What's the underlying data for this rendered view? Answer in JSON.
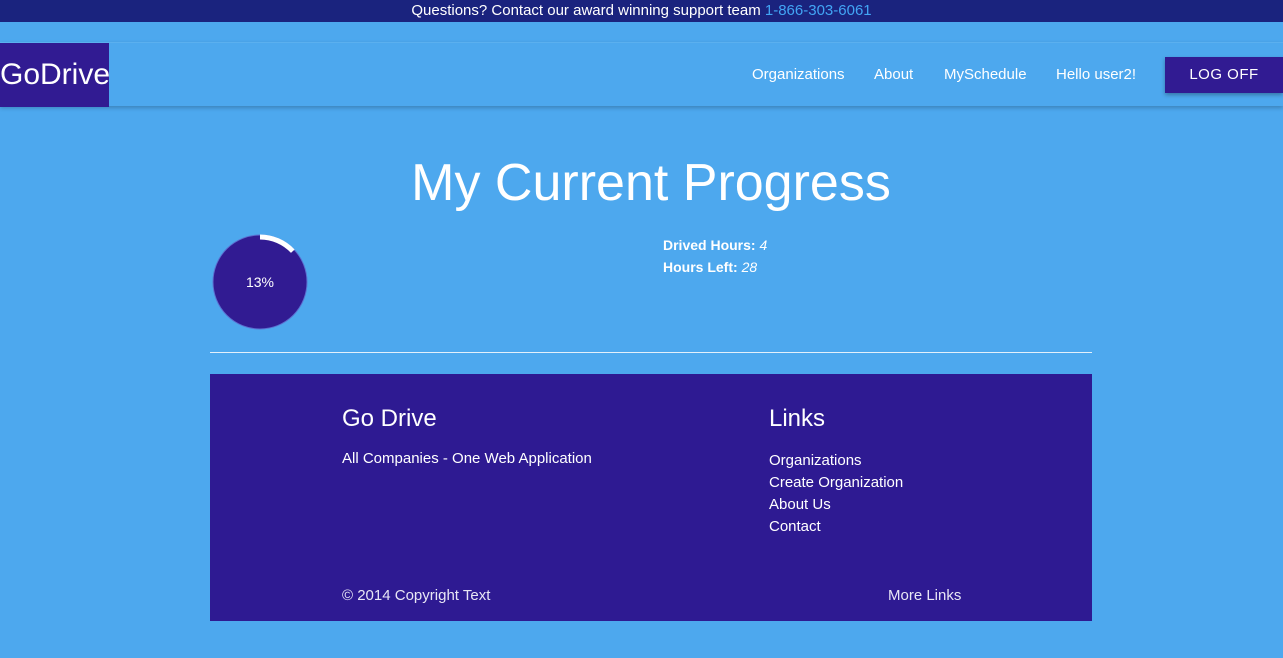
{
  "topbar": {
    "message": "Questions? Contact our award winning support team",
    "phone": "1-866-303-6061"
  },
  "navbar": {
    "brand": "GoDrive",
    "links": [
      "Organizations",
      "About",
      "MySchedule"
    ],
    "greeting": "Hello user2!",
    "logoff_label": "LOG OFF"
  },
  "main": {
    "title": "My Current Progress",
    "progress": {
      "percent_label": "13%",
      "fraction": 0.13
    },
    "stats": {
      "drived_label": "Drived Hours:",
      "drived_value": "4",
      "left_label": "Hours Left:",
      "left_value": "28"
    }
  },
  "footer": {
    "brand_heading": "Go Drive",
    "tagline": "All Companies - One Web Application",
    "links_heading": "Links",
    "links": [
      "Organizations",
      "Create Organization",
      "About Us",
      "Contact"
    ],
    "copyright": "© 2014 Copyright Text",
    "more_links": "More Links"
  },
  "colors": {
    "page_bg": "#4da8ee",
    "accent_dark": "#311b92",
    "topbar_bg": "#1a237e",
    "phone_link": "#42a5f5"
  }
}
